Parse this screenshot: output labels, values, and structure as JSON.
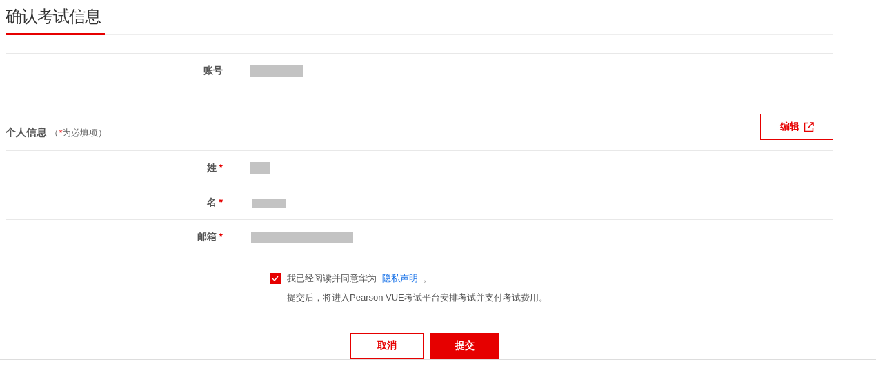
{
  "title": "确认考试信息",
  "account": {
    "label": "账号",
    "redacted": true
  },
  "personal": {
    "heading": "个人信息",
    "note": {
      "open": "（",
      "mark": "*",
      "rest": "为必填项）"
    },
    "edit_button": "编辑",
    "rows": [
      {
        "label": "姓",
        "mark": "*",
        "redacted": true
      },
      {
        "label": "名",
        "mark": "*",
        "redacted": true
      },
      {
        "label": "邮箱",
        "mark": "*",
        "redacted": true
      }
    ]
  },
  "agreement": {
    "checked": true,
    "before": "我已经阅读并同意华为",
    "link": "隐私声明",
    "after": "。"
  },
  "notice": "提交后，将进入Pearson VUE考试平台安排考试并支付考试费用。",
  "buttons": {
    "cancel": "取消",
    "submit": "提交"
  }
}
